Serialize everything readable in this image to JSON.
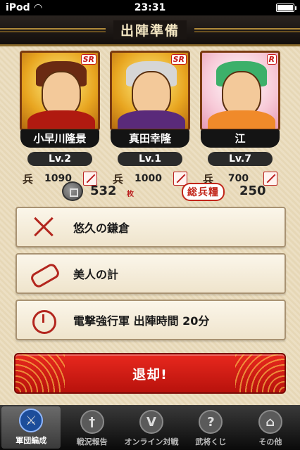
{
  "status_bar": {
    "carrier": "iPod",
    "time": "23:31"
  },
  "header": {
    "title": "出陣準備"
  },
  "generals": [
    {
      "name": "小早川隆景",
      "rarity": "SR",
      "level": "Lv.2",
      "troops_label": "兵",
      "troops": "1090"
    },
    {
      "name": "真田幸隆",
      "rarity": "SR",
      "level": "Lv.1",
      "troops_label": "兵",
      "troops": "1000"
    },
    {
      "name": "江",
      "rarity": "R",
      "level": "Lv.7",
      "troops_label": "兵",
      "troops": "700"
    }
  ],
  "resources": {
    "coins": "532",
    "coins_unit": "枚",
    "total_troops_label": "総兵糧",
    "total_troops": "250"
  },
  "menu": [
    {
      "label": "悠久の鎌倉",
      "icon": "crossed-swords-icon"
    },
    {
      "label": "美人の計",
      "icon": "scroll-icon"
    },
    {
      "label": "電撃強行軍 出陣時間 20分",
      "icon": "stopwatch-icon"
    }
  ],
  "retreat_button": {
    "label": "退却!"
  },
  "tabs": [
    {
      "label": "軍団編成",
      "icon": "helmet-icon",
      "active": true
    },
    {
      "label": "戦況報告",
      "icon": "sword-icon"
    },
    {
      "label": "オンライン対戦",
      "icon": "vs-icon"
    },
    {
      "label": "武将くじ",
      "icon": "question-icon"
    },
    {
      "label": "その他",
      "icon": "temple-icon"
    }
  ]
}
